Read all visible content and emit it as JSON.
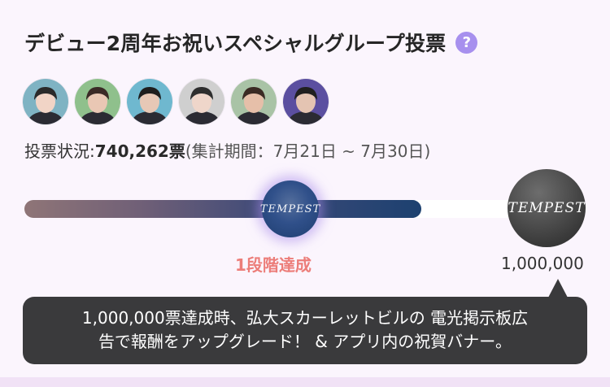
{
  "header": {
    "title": "デビュー2周年お祝いスペシャルグループ投票",
    "help_glyph": "?"
  },
  "avatars": [
    {
      "name": "member-1",
      "bg": "#7fb3c3",
      "skin": "#f1d4c6",
      "hair": "#2a2a2a"
    },
    {
      "name": "member-2",
      "bg": "#8fc08c",
      "skin": "#e9c7b4",
      "hair": "#3a2a26"
    },
    {
      "name": "member-3",
      "bg": "#6fb8cf",
      "skin": "#e7c8b6",
      "hair": "#1e1e1e"
    },
    {
      "name": "member-4",
      "bg": "#cfcfcf",
      "skin": "#efd6ca",
      "hair": "#2e2e2e"
    },
    {
      "name": "member-5",
      "bg": "#a9c3a6",
      "skin": "#e6bfa9",
      "hair": "#3b2b24"
    },
    {
      "name": "member-6",
      "bg": "#5b4fa0",
      "skin": "#e4c4b2",
      "hair": "#202020"
    }
  ],
  "vote": {
    "label": "投票状況:",
    "count": "740,262票",
    "period": "(集計期間：7月21日 ~ 7月30日)"
  },
  "progress": {
    "fraction": 0.74,
    "milestone_1_logo": "TEMPEST",
    "milestone_2_logo": "TEMPEST",
    "stage_label": "1段階達成",
    "goal_label": "1,000,000"
  },
  "tooltip": {
    "line1": "1,000,000票達成時、弘大スカーレットビルの 電光掲示板広",
    "line2": "告で報酬をアップグレード！ & アプリ内の祝賀バナー。"
  },
  "colors": {
    "accent_help": "#a790ee",
    "stage_label": "#ec7d79",
    "tooltip_bg": "#3a3a3c"
  }
}
